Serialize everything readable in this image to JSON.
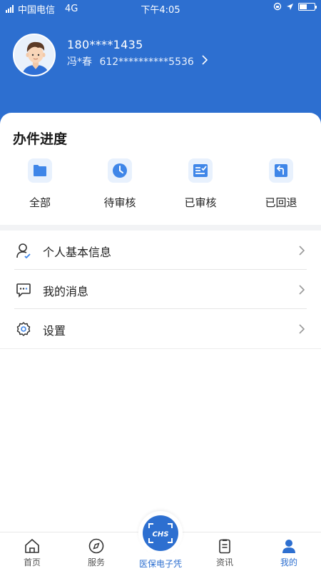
{
  "status_bar": {
    "carrier": "中国电信",
    "network": "4G",
    "time": "下午4:05"
  },
  "user": {
    "phone": "180****1435",
    "name": "冯*春",
    "id_number": "612**********5536"
  },
  "progress": {
    "title": "办件进度",
    "items": [
      {
        "label": "全部",
        "icon": "folder-icon"
      },
      {
        "label": "待审核",
        "icon": "clock-icon"
      },
      {
        "label": "已审核",
        "icon": "checklist-icon"
      },
      {
        "label": "已回退",
        "icon": "return-icon"
      }
    ]
  },
  "menu": {
    "items": [
      {
        "label": "个人基本信息",
        "icon": "person-icon"
      },
      {
        "label": "我的消息",
        "icon": "message-icon"
      },
      {
        "label": "设置",
        "icon": "gear-icon"
      }
    ]
  },
  "tabbar": {
    "items": [
      {
        "label": "首页",
        "icon": "home-icon"
      },
      {
        "label": "服务",
        "icon": "compass-icon"
      },
      {
        "label": "医保电子凭证",
        "icon": "chs-scan-icon",
        "badge": "CHS"
      },
      {
        "label": "资讯",
        "icon": "clipboard-icon"
      },
      {
        "label": "我的",
        "icon": "person-icon"
      }
    ],
    "active_index": 4
  },
  "colors": {
    "brand_blue": "#2d6fd0",
    "icon_bg": "#e8f1fd"
  }
}
